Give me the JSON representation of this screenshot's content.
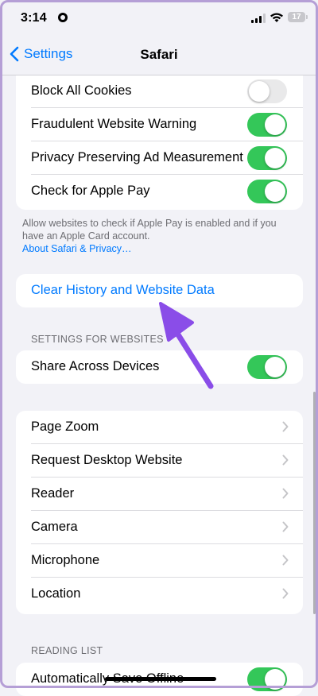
{
  "status": {
    "time": "3:14",
    "battery": "17"
  },
  "nav": {
    "back_label": "Settings",
    "title": "Safari"
  },
  "privacy_group": {
    "rows": [
      {
        "label": "Block All Cookies",
        "toggle": "off"
      },
      {
        "label": "Fraudulent Website Warning",
        "toggle": "on"
      },
      {
        "label": "Privacy Preserving Ad Measurement",
        "toggle": "on"
      },
      {
        "label": "Check for Apple Pay",
        "toggle": "on"
      }
    ],
    "footnote": "Allow websites to check if Apple Pay is enabled and if you have an Apple Card account.",
    "footnote_link": "About Safari & Privacy…"
  },
  "clear_history": {
    "label": "Clear History and Website Data"
  },
  "settings_for_websites": {
    "header": "SETTINGS FOR WEBSITES",
    "share_label": "Share Across Devices",
    "share_toggle": "on"
  },
  "website_settings": {
    "rows": [
      {
        "label": "Page Zoom"
      },
      {
        "label": "Request Desktop Website"
      },
      {
        "label": "Reader"
      },
      {
        "label": "Camera"
      },
      {
        "label": "Microphone"
      },
      {
        "label": "Location"
      }
    ]
  },
  "reading_list": {
    "header": "READING LIST",
    "auto_save_label": "Automatically Save Offline",
    "auto_save_toggle": "on"
  },
  "colors": {
    "accent": "#007aff",
    "toggle_on": "#34c759",
    "annotation_arrow": "#8a4de8",
    "background": "#f2f2f7"
  }
}
